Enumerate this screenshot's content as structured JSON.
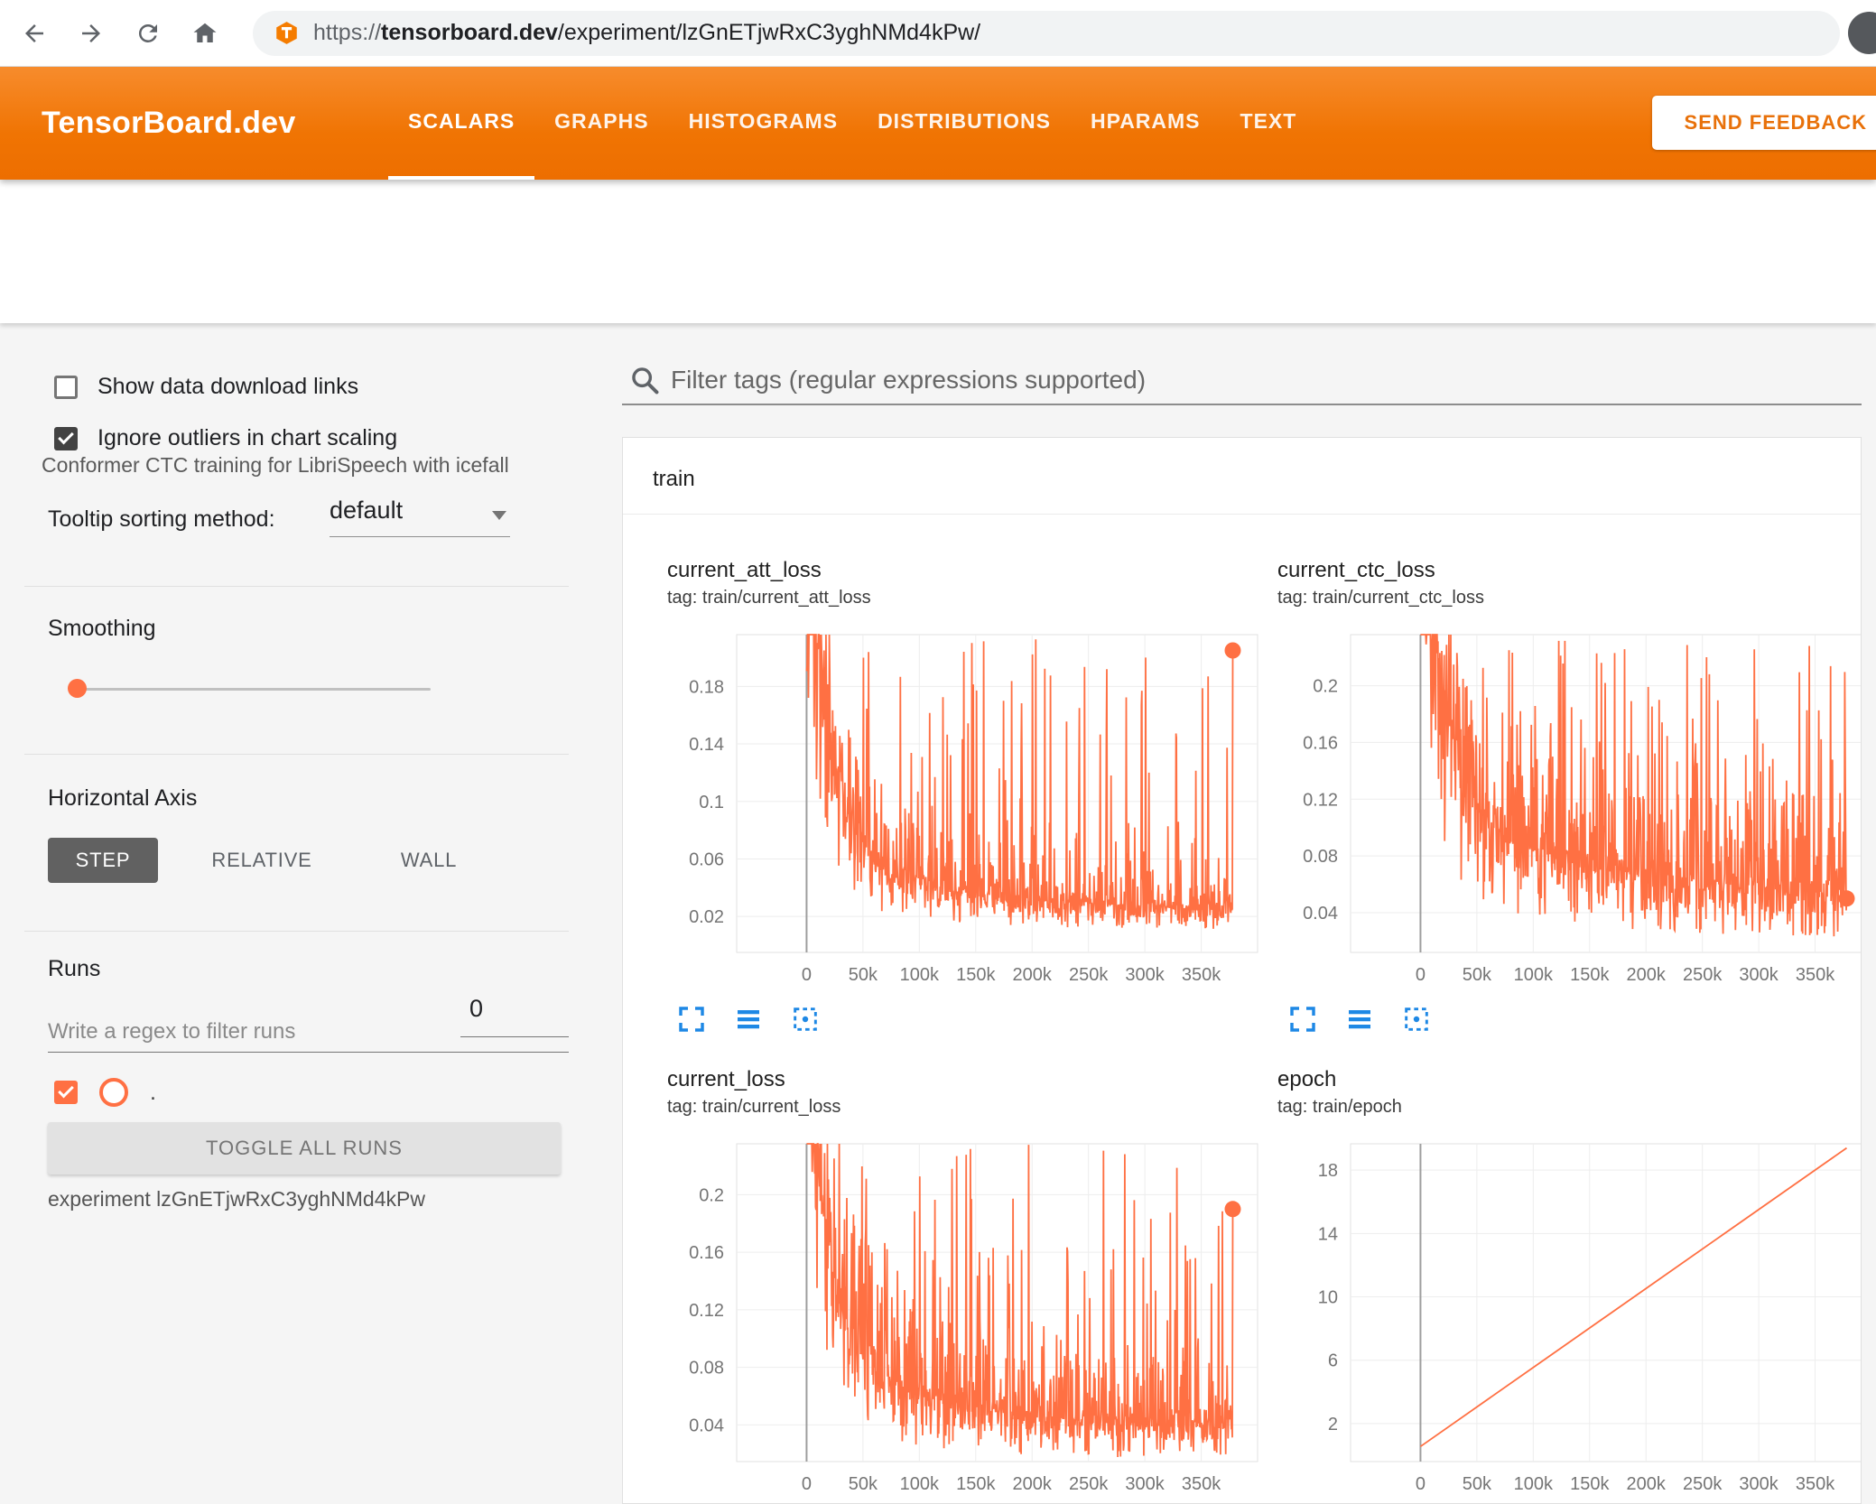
{
  "browser": {
    "url": {
      "scheme": "https://",
      "domain": "tensorboard.dev",
      "path": "/experiment/lzGnETjwRxC3yghNMd4kPw/"
    }
  },
  "header": {
    "brand": "TensorBoard.dev",
    "tabs": [
      {
        "label": "SCALARS",
        "active": true
      },
      {
        "label": "GRAPHS",
        "active": false
      },
      {
        "label": "HISTOGRAMS",
        "active": false
      },
      {
        "label": "DISTRIBUTIONS",
        "active": false
      },
      {
        "label": "HPARAMS",
        "active": false
      },
      {
        "label": "TEXT",
        "active": false
      }
    ],
    "feedback": "SEND FEEDBACK"
  },
  "experiment_title": "Conformer CTC training for LibriSpeech with icefall",
  "sidebar": {
    "show_download_label": "Show data download links",
    "show_download_checked": false,
    "ignore_outliers_label": "Ignore outliers in chart scaling",
    "ignore_outliers_checked": true,
    "tooltip_label": "Tooltip sorting method:",
    "tooltip_value": "default",
    "smoothing_label": "Smoothing",
    "smoothing_value": "0",
    "axis_label": "Horizontal Axis",
    "axis_step": "STEP",
    "axis_relative": "RELATIVE",
    "axis_wall": "WALL",
    "axis_selected": "STEP",
    "runs_label": "Runs",
    "runs_placeholder": "Write a regex to filter runs",
    "run_name": ".",
    "run_checked": true,
    "toggle_all": "TOGGLE ALL RUNS",
    "experiment_line": "experiment lzGnETjwRxC3yghNMd4kPw"
  },
  "main": {
    "filter_placeholder": "Filter tags (regular expressions supported)",
    "section": "train"
  },
  "colors": {
    "header": "#f57c00",
    "line": "#ff7043",
    "icons": "#1e88e5"
  },
  "chart_data": [
    {
      "type": "line",
      "title": "current_att_loss",
      "tag": "tag: train/current_att_loss",
      "run": "train",
      "xlim": [
        -62000,
        400000
      ],
      "ylim": [
        -0.005,
        0.216
      ],
      "xtick_vals": [
        0,
        50000,
        100000,
        150000,
        200000,
        250000,
        300000,
        350000
      ],
      "xtick_labels": [
        "0",
        "50k",
        "100k",
        "150k",
        "200k",
        "250k",
        "300k",
        "350k"
      ],
      "ytick_vals": [
        0.02,
        0.06,
        0.1,
        0.14,
        0.18
      ],
      "ytick_labels": [
        "0.02",
        "0.06",
        "0.1",
        "0.14",
        "0.18"
      ],
      "data_range": [
        0,
        378000
      ],
      "trend": [
        [
          0,
          0.3
        ],
        [
          8000,
          0.22
        ],
        [
          15000,
          0.15
        ],
        [
          25000,
          0.1
        ],
        [
          40000,
          0.075
        ],
        [
          60000,
          0.055
        ],
        [
          90000,
          0.042
        ],
        [
          130000,
          0.035
        ],
        [
          180000,
          0.03
        ],
        [
          240000,
          0.027
        ],
        [
          310000,
          0.025
        ],
        [
          378000,
          0.024
        ]
      ],
      "noise": {
        "seed": 11,
        "spike_prob": 0.1,
        "spike_max": 0.215
      },
      "end_value": 0.205,
      "end_dot": true
    },
    {
      "type": "line",
      "title": "current_ctc_loss",
      "tag": "tag: train/current_ctc_loss",
      "run": "train",
      "xlim": [
        -62000,
        400000
      ],
      "ylim": [
        0.012,
        0.236
      ],
      "xtick_vals": [
        0,
        50000,
        100000,
        150000,
        200000,
        250000,
        300000,
        350000
      ],
      "xtick_labels": [
        "0",
        "50k",
        "100k",
        "150k",
        "200k",
        "250k",
        "300k",
        "350k"
      ],
      "ytick_vals": [
        0.04,
        0.08,
        0.12,
        0.16,
        0.2
      ],
      "ytick_labels": [
        "0.04",
        "0.08",
        "0.12",
        "0.16",
        "0.2"
      ],
      "data_range": [
        0,
        378000
      ],
      "trend": [
        [
          0,
          0.35
        ],
        [
          8000,
          0.26
        ],
        [
          15000,
          0.2
        ],
        [
          25000,
          0.15
        ],
        [
          40000,
          0.12
        ],
        [
          60000,
          0.1
        ],
        [
          90000,
          0.085
        ],
        [
          130000,
          0.072
        ],
        [
          180000,
          0.063
        ],
        [
          240000,
          0.057
        ],
        [
          310000,
          0.052
        ],
        [
          378000,
          0.05
        ]
      ],
      "noise": {
        "seed": 23,
        "spike_prob": 0.1,
        "spike_max": 0.235
      },
      "end_value": 0.05,
      "end_dot": true
    },
    {
      "type": "line",
      "title": "current_loss",
      "tag": "tag: train/current_loss",
      "run": "train",
      "xlim": [
        -62000,
        400000
      ],
      "ylim": [
        0.0145,
        0.2354
      ],
      "xtick_vals": [
        0,
        50000,
        100000,
        150000,
        200000,
        250000,
        300000,
        350000
      ],
      "xtick_labels": [
        "0",
        "50k",
        "100k",
        "150k",
        "200k",
        "250k",
        "300k",
        "350k"
      ],
      "ytick_vals": [
        0.04,
        0.08,
        0.12,
        0.16,
        0.2
      ],
      "ytick_labels": [
        "0.04",
        "0.08",
        "0.12",
        "0.16",
        "0.2"
      ],
      "data_range": [
        0,
        378000
      ],
      "trend": [
        [
          0,
          0.33
        ],
        [
          8000,
          0.24
        ],
        [
          15000,
          0.17
        ],
        [
          25000,
          0.12
        ],
        [
          40000,
          0.095
        ],
        [
          60000,
          0.075
        ],
        [
          90000,
          0.06
        ],
        [
          130000,
          0.05
        ],
        [
          180000,
          0.044
        ],
        [
          240000,
          0.04
        ],
        [
          310000,
          0.038
        ],
        [
          378000,
          0.037
        ]
      ],
      "noise": {
        "seed": 37,
        "spike_prob": 0.1,
        "spike_max": 0.235
      },
      "end_value": 0.19,
      "end_dot": true
    },
    {
      "type": "line",
      "title": "epoch",
      "tag": "tag: train/epoch",
      "run": "train",
      "xlim": [
        -62000,
        400000
      ],
      "ylim": [
        -0.4,
        19.66
      ],
      "xtick_vals": [
        0,
        50000,
        100000,
        150000,
        200000,
        250000,
        300000,
        350000
      ],
      "xtick_labels": [
        "0",
        "50k",
        "100k",
        "150k",
        "200k",
        "250k",
        "300k",
        "350k"
      ],
      "ytick_vals": [
        2,
        6,
        10,
        14,
        18
      ],
      "ytick_labels": [
        "2",
        "6",
        "10",
        "14",
        "18"
      ],
      "points": [
        [
          0,
          0.55
        ],
        [
          378000,
          19.4
        ]
      ],
      "end_dot": false
    }
  ]
}
